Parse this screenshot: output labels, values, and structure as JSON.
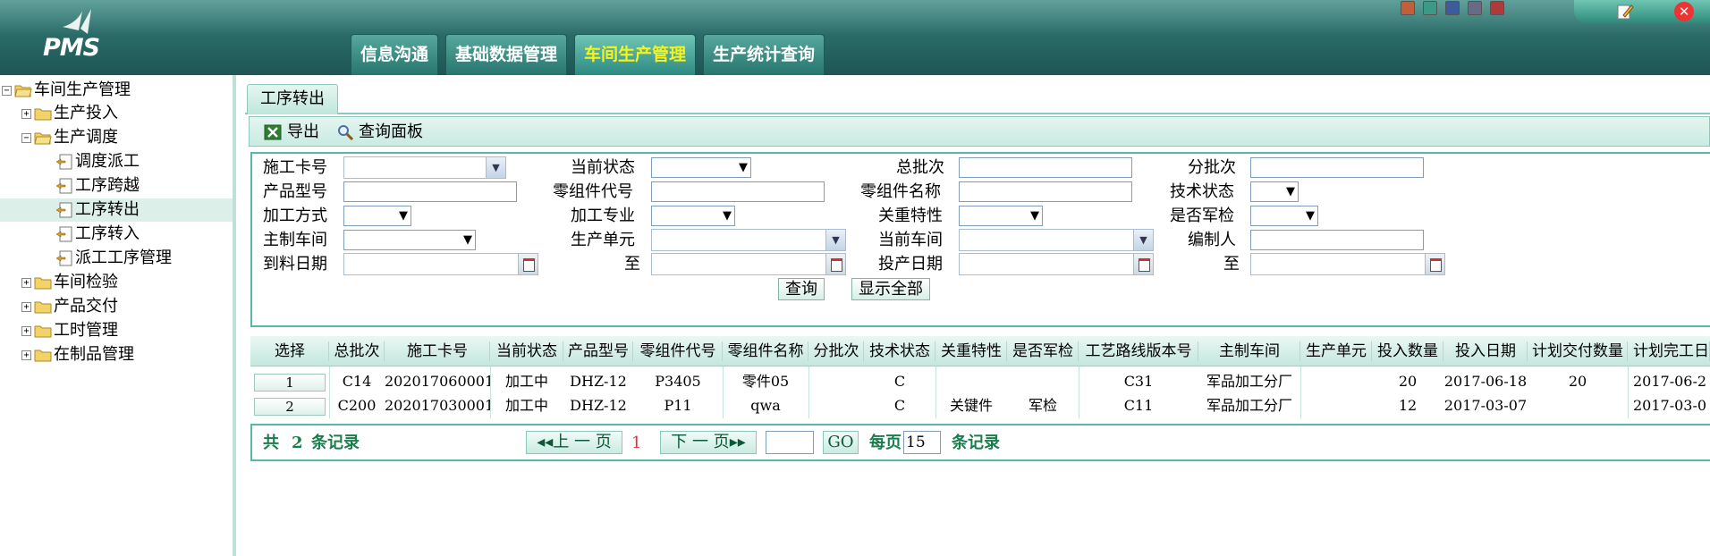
{
  "header": {
    "logo_text": "PMS",
    "tabs": [
      {
        "label": "信息沟通"
      },
      {
        "label": "基础数据管理"
      },
      {
        "label": "车间生产管理"
      },
      {
        "label": "生产统计查询"
      }
    ],
    "active_tab_color": "#f6f31c",
    "window_button_colors": [
      "#c0603a",
      "#3a9a86",
      "#3c5c9c",
      "#6a6a86",
      "#b03a3a"
    ]
  },
  "tree": {
    "items": [
      {
        "label": "车间生产管理",
        "icon": "folder-open-icon",
        "toggle": "−"
      },
      {
        "label": "生产投入",
        "icon": "folder-icon",
        "toggle": "+"
      },
      {
        "label": "生产调度",
        "icon": "folder-open-icon",
        "toggle": "−"
      },
      {
        "label": "调度派工",
        "icon": "page-icon"
      },
      {
        "label": "工序跨越",
        "icon": "page-icon"
      },
      {
        "label": "工序转出",
        "icon": "page-icon",
        "selected": true
      },
      {
        "label": "工序转入",
        "icon": "page-icon"
      },
      {
        "label": "派工工序管理",
        "icon": "page-icon"
      },
      {
        "label": "车间检验",
        "icon": "folder-icon",
        "toggle": "+"
      },
      {
        "label": "产品交付",
        "icon": "folder-icon",
        "toggle": "+"
      },
      {
        "label": "工时管理",
        "icon": "folder-icon",
        "toggle": "+"
      },
      {
        "label": "在制品管理",
        "icon": "folder-icon",
        "toggle": "+"
      }
    ]
  },
  "content": {
    "tab_label": "工序转出",
    "toolbar": {
      "export_label": "导出",
      "query_panel_label": "查询面板"
    },
    "query": {
      "f_card_no": "施工卡号",
      "f_cur_status": "当前状态",
      "f_total_batch": "总批次",
      "f_sub_batch": "分批次",
      "f_product_model": "产品型号",
      "f_part_code": "零组件代号",
      "f_part_name": "零组件名称",
      "f_tech_status": "技术状态",
      "f_process_mode": "加工方式",
      "f_process_major": "加工专业",
      "f_key_feature": "关重特性",
      "f_military_check": "是否军检",
      "f_main_workshop": "主制车间",
      "f_prod_unit": "生产单元",
      "f_cur_workshop": "当前车间",
      "f_author": "编制人",
      "f_arrival_date": "到料日期",
      "f_to": "至",
      "f_start_date": "投产日期",
      "f_to2": "至",
      "query_btn": "查询",
      "show_all_btn": "显示全部"
    },
    "grid": {
      "columns": [
        "选择",
        "总批次",
        "施工卡号",
        "当前状态",
        "产品型号",
        "零组件代号",
        "零组件名称",
        "分批次",
        "技术状态",
        "关重特性",
        "是否军检",
        "工艺路线版本号",
        "主制车间",
        "生产单元",
        "投入数量",
        "投入日期",
        "计划交付数量",
        "计划完工日"
      ],
      "rows": [
        [
          "1",
          "C14",
          "202017060001",
          "加工中",
          "DHZ-12",
          "P3405",
          "零件05",
          "",
          "C",
          "",
          "",
          "C31",
          "军品加工分厂",
          "",
          "20",
          "2017-06-18",
          "20",
          "2017-06-2"
        ],
        [
          "2",
          "C200",
          "202017030001",
          "加工中",
          "DHZ-12",
          "P11",
          "qwa",
          "",
          "C",
          "关键件",
          "军检",
          "C11",
          "军品加工分厂",
          "",
          "12",
          "2017-03-07",
          "",
          "2017-03-0"
        ]
      ]
    },
    "pager": {
      "total_prefix": "共",
      "total_count": "2",
      "total_suffix": "条记录",
      "prev_label": "上 一 页",
      "current_page": "1",
      "next_label": "下 一 页",
      "go_label": "GO",
      "per_page_prefix": "每页",
      "per_page_value": "15",
      "per_page_suffix": "条记录"
    }
  }
}
